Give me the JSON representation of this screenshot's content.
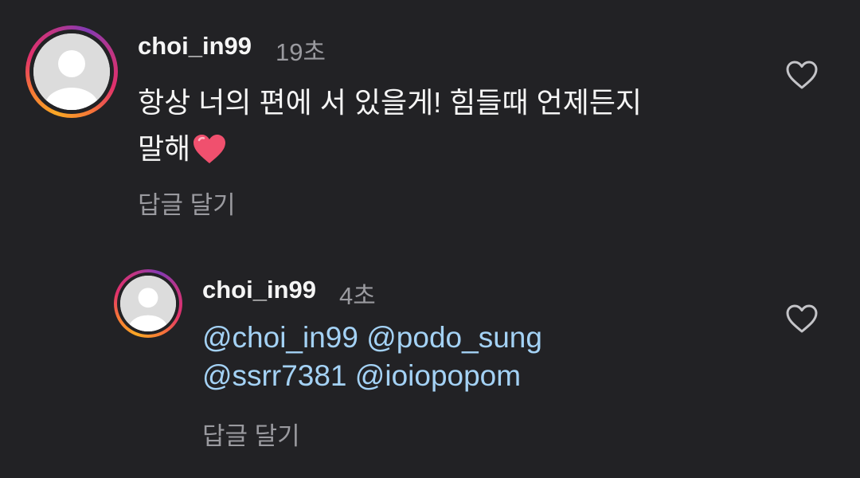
{
  "comments": [
    {
      "username": "choi_in99",
      "time": "19초",
      "text_line1": "항상 너의 편에 서 있을게! 힘들때 언제든지",
      "text_line2": "말해",
      "emoji": "heart",
      "reply_label": "답글 달기",
      "liked": false
    },
    {
      "username": "choi_in99",
      "time": "4초",
      "mentions_line1": [
        "@choi_in99",
        "@podo_sung"
      ],
      "mentions_line2": [
        "@ssrr7381",
        "@ioiopopom"
      ],
      "reply_label": "답글 달기",
      "liked": false
    }
  ],
  "colors": {
    "background": "#222225",
    "text": "#f5f5f5",
    "muted": "#9a9a9f",
    "mention": "#a4d2f5",
    "heart_emoji": "#f0506e"
  }
}
